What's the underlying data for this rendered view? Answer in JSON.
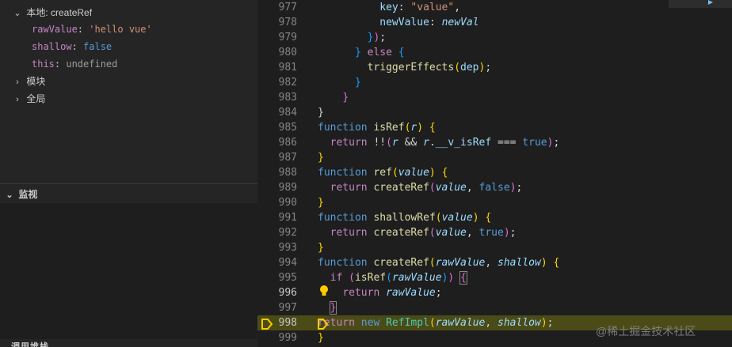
{
  "variables": {
    "section_label": "本地: createRef",
    "items": [
      {
        "name": "rawValue",
        "value": "'hello vue'"
      },
      {
        "name": "shallow",
        "value": "false"
      },
      {
        "name": "this",
        "value": "undefined"
      }
    ],
    "groups": [
      "模块",
      "全局"
    ]
  },
  "watch": {
    "title": "监视"
  },
  "callstack": {
    "title": "调用堆栈"
  },
  "editor": {
    "current_line": "998",
    "line_numbers": [
      "977",
      "978",
      "979",
      "980",
      "981",
      "982",
      "983",
      "984",
      "985",
      "986",
      "987",
      "988",
      "989",
      "990",
      "991",
      "992",
      "993",
      "994",
      "995",
      "996",
      "997",
      "998",
      "999"
    ]
  },
  "watermark": "@稀土掘金技术社区",
  "colors": {
    "editor_bg": "#1e1e1e",
    "sidebar_bg": "#252526",
    "current_line_bg": "#4b4b18",
    "breakpoint": "#ffcc00"
  }
}
